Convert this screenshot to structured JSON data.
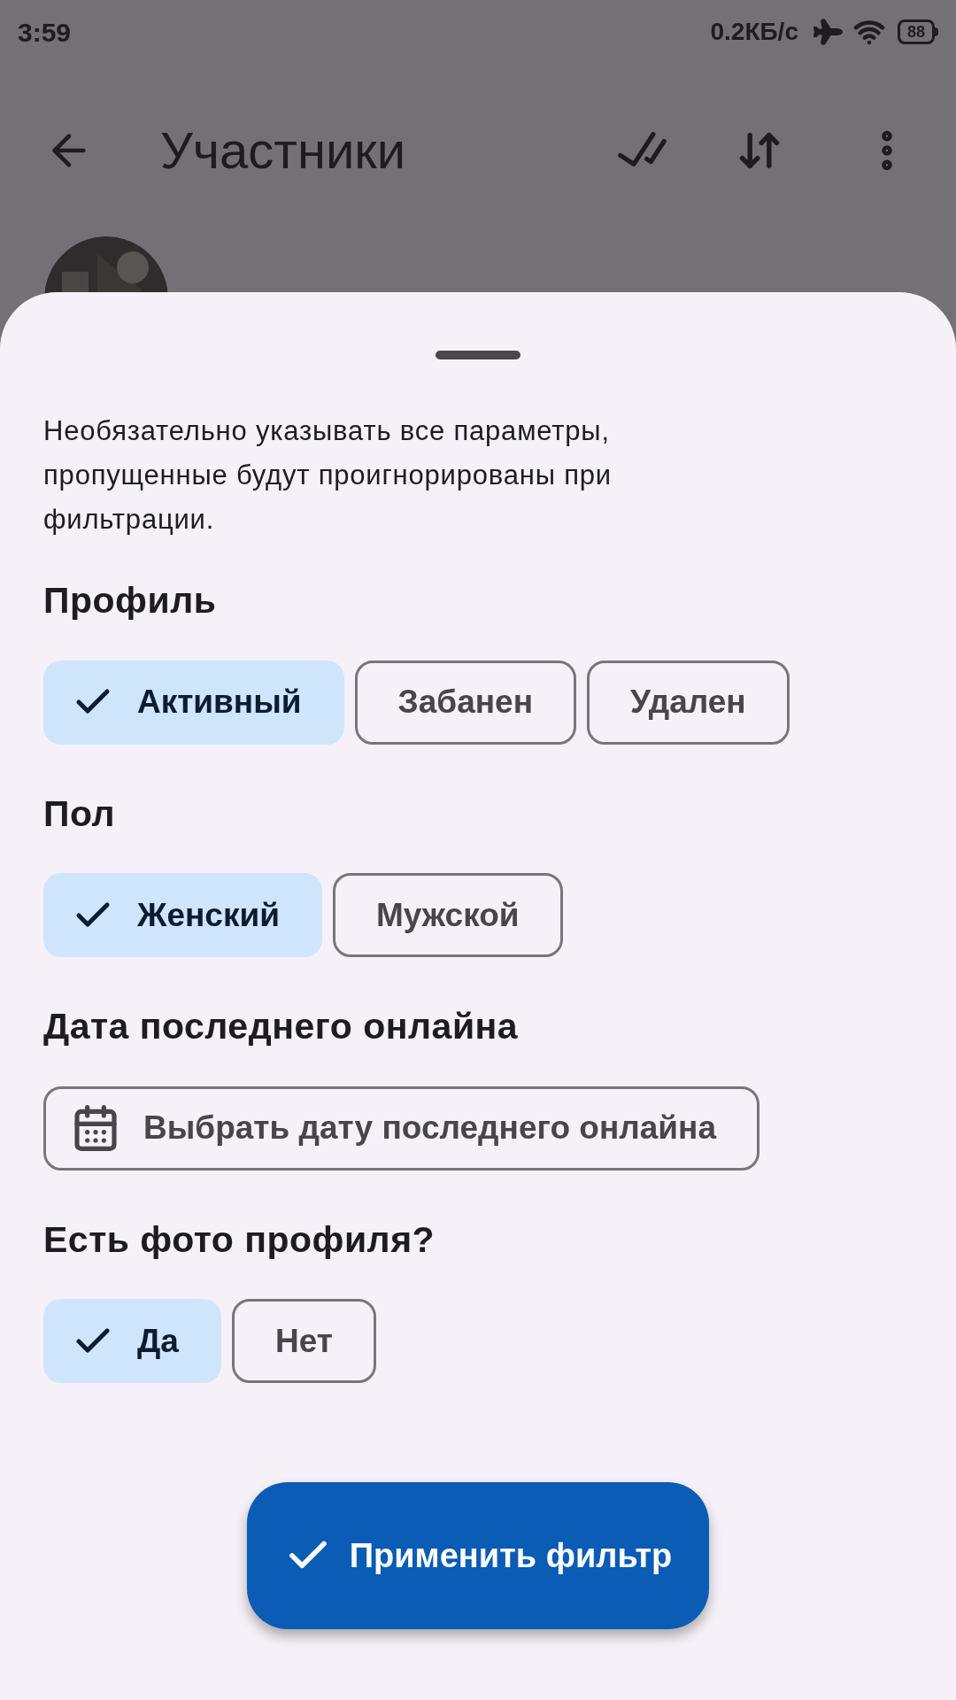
{
  "status_bar": {
    "time": "3:59",
    "speed": "0.2КБ/с",
    "battery": "88"
  },
  "toolbar": {
    "title": "Участники"
  },
  "sheet": {
    "hint": "Необязательно указывать все параметры, пропущенные будут проигнорированы при фильтрации.",
    "sections": [
      {
        "title": "Профиль",
        "kind": "chips",
        "chips": [
          {
            "label": "Активный",
            "selected": true
          },
          {
            "label": "Забанен",
            "selected": false
          },
          {
            "label": "Удален",
            "selected": false
          }
        ]
      },
      {
        "title": "Пол",
        "kind": "chips",
        "chips": [
          {
            "label": "Женский",
            "selected": true
          },
          {
            "label": "Мужской",
            "selected": false
          }
        ]
      },
      {
        "title": "Дата последнего онлайна",
        "kind": "date",
        "button": "Выбрать дату последнего онлайна"
      },
      {
        "title": "Есть фото профиля?",
        "kind": "chips",
        "chips": [
          {
            "label": "Да",
            "selected": true
          },
          {
            "label": "Нет",
            "selected": false
          }
        ]
      }
    ],
    "apply": "Применить фильтр"
  }
}
